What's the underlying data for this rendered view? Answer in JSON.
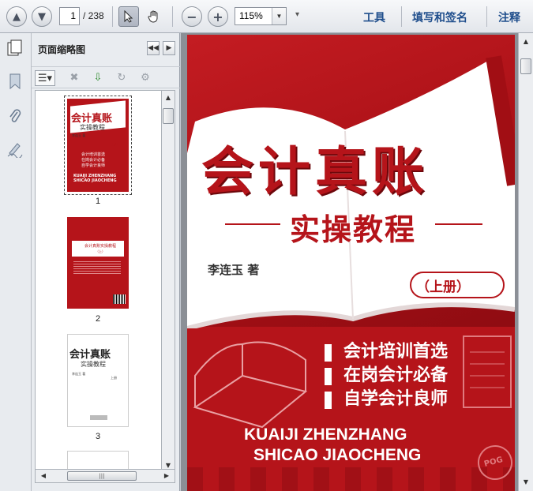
{
  "toolbar": {
    "page_current": "1",
    "page_total": "/ 238",
    "zoom": "115%",
    "links": [
      "工具",
      "填写和签名",
      "注释"
    ]
  },
  "panel": {
    "title": "页面缩略图",
    "thumbnails": [
      {
        "number": "1"
      },
      {
        "number": "2"
      },
      {
        "number": "3"
      }
    ]
  },
  "cover": {
    "title": "会计真账",
    "subtitle": "实操教程",
    "author": "李连玉 著",
    "volume": "（上册）",
    "taglines": [
      "会计培训首选",
      "在岗会计必备",
      "自学会计良师"
    ],
    "pinyin_line1": "KUAIJI ZHENZHANG",
    "pinyin_line2": "SHICAO JIAOCHENG",
    "stamp_text": "POG"
  },
  "thumb_texts": {
    "t1_title": "会计真账",
    "t1_sub": "实操教程",
    "t1_author": "李连玉 著",
    "t1_vol": "（上册）",
    "t1_lines": [
      "会计培训首选",
      "在岗会计必备",
      "自学会计良师"
    ],
    "t1_pinyin1": "KUAIJI ZHENZHANG",
    "t1_pinyin2": "SHICAO JIAOCHENG",
    "t2_title": "会计真账实操教程",
    "t2_vol": "（上）",
    "t3_title": "会计真账",
    "t3_sub": "实操教程",
    "t3_author": "李连玉 著",
    "t3_vol": "上册"
  },
  "colors": {
    "cover_red": "#b5141a",
    "link_blue": "#1f4e8c"
  }
}
